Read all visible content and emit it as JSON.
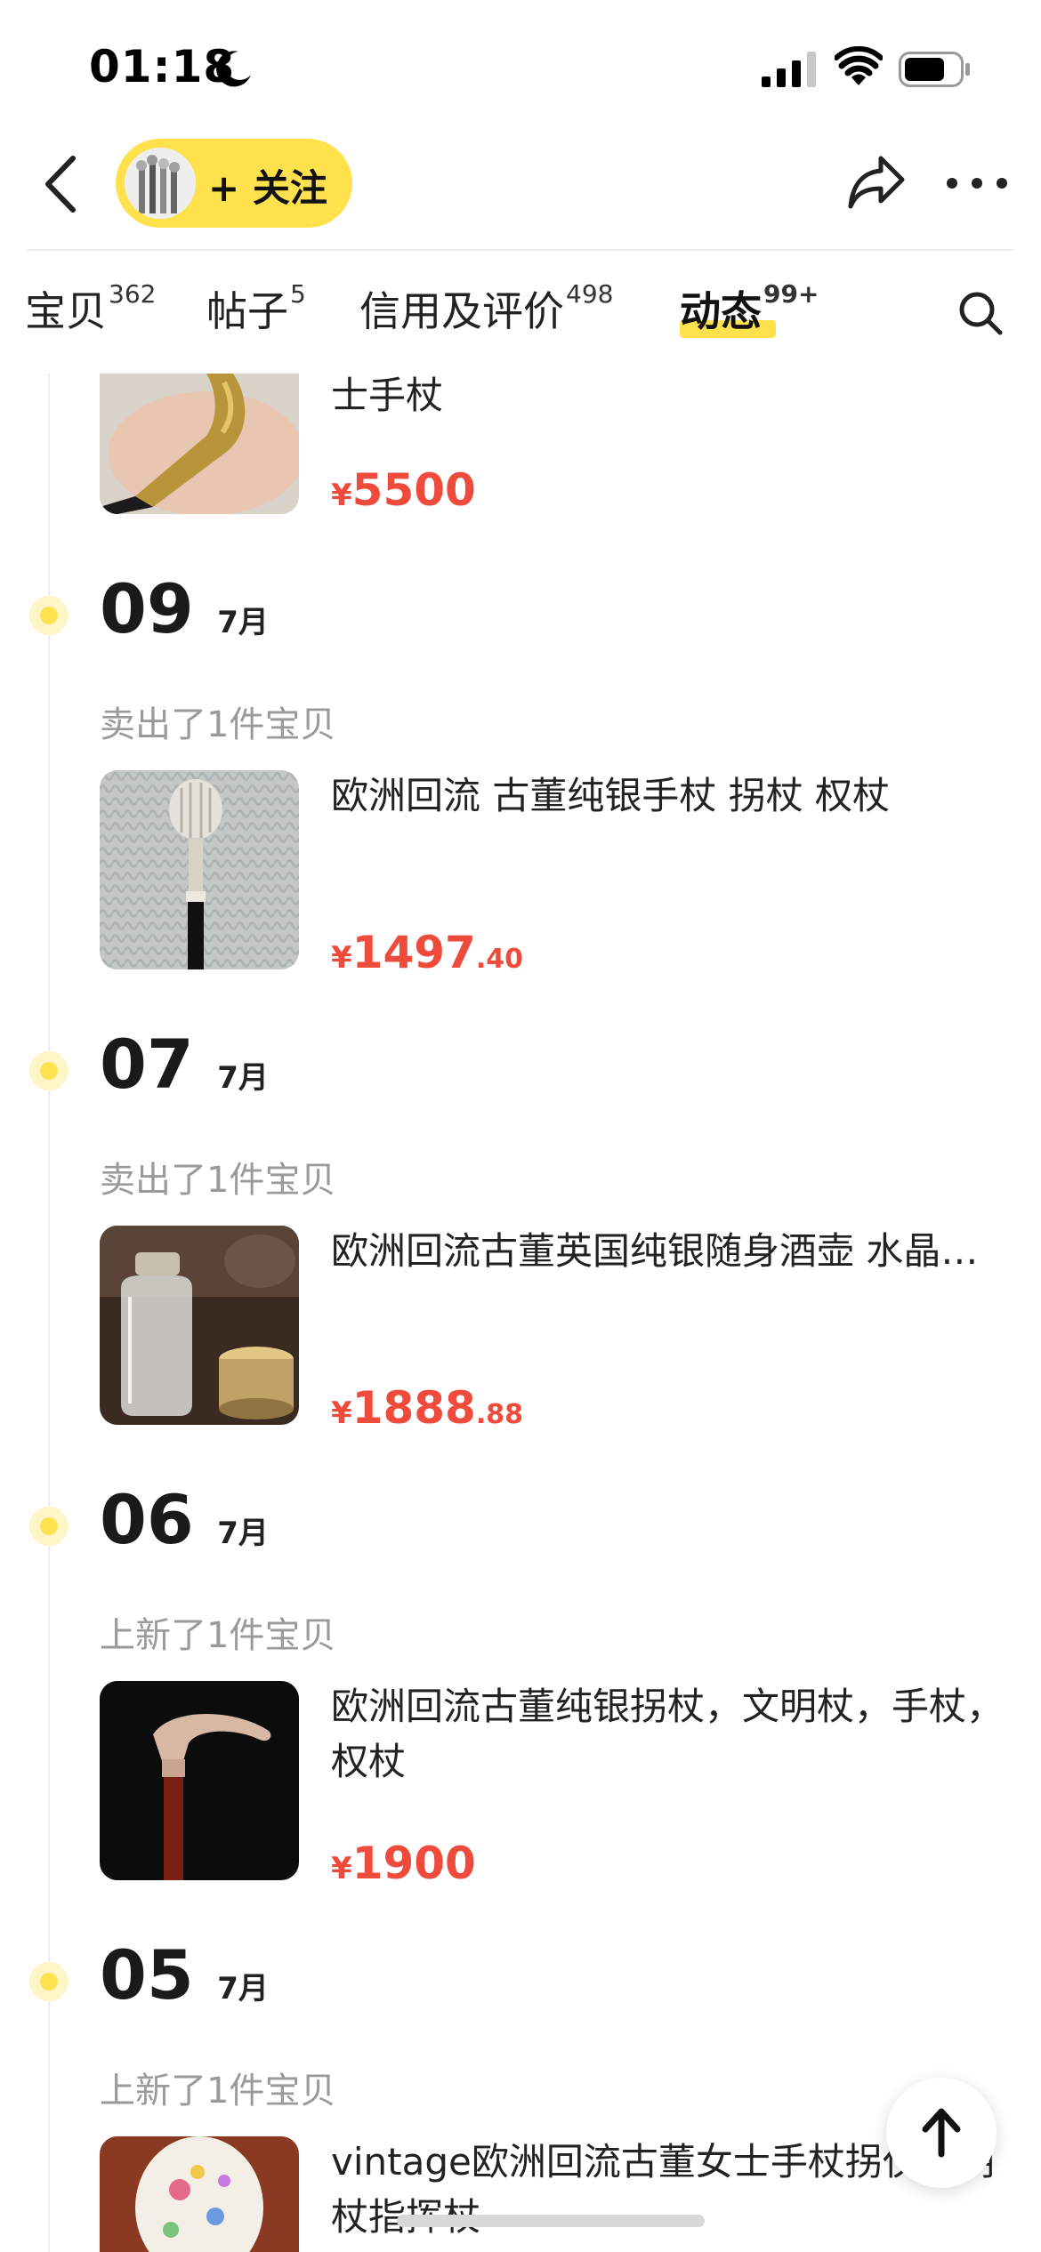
{
  "status_bar": {
    "time": "01:18"
  },
  "nav": {
    "follow_label": "+ 关注"
  },
  "tabs": [
    {
      "label": "宝贝",
      "count": "362"
    },
    {
      "label": "帖子",
      "count": "5"
    },
    {
      "label": "信用及评价",
      "count": "498"
    },
    {
      "label": "动态",
      "count": "99+"
    }
  ],
  "top_item": {
    "title_tail": "士手杖",
    "currency": "¥",
    "price_int": "5500",
    "price_dec": ""
  },
  "entries": [
    {
      "day": "09",
      "month": "7月",
      "action": "卖出了1件宝贝",
      "title": "欧洲回流 古董纯银手杖 拐杖 权杖",
      "currency": "¥",
      "price_int": "1497",
      "price_dec": ".40"
    },
    {
      "day": "07",
      "month": "7月",
      "action": "卖出了1件宝贝",
      "title": "欧洲回流古董英国纯银随身酒壶 水晶…",
      "currency": "¥",
      "price_int": "1888",
      "price_dec": ".88"
    },
    {
      "day": "06",
      "month": "7月",
      "action": "上新了1件宝贝",
      "title": "欧洲回流古董纯银拐杖，文明杖，手杖，权杖",
      "currency": "¥",
      "price_int": "1900",
      "price_dec": ""
    },
    {
      "day": "05",
      "month": "7月",
      "action": "上新了1件宝贝",
      "title": "vintage欧洲回流古董女士手杖拐仗文明杖指挥杖"
    }
  ],
  "colors": {
    "accent": "#ffe14d",
    "price": "#ef4b3c"
  }
}
